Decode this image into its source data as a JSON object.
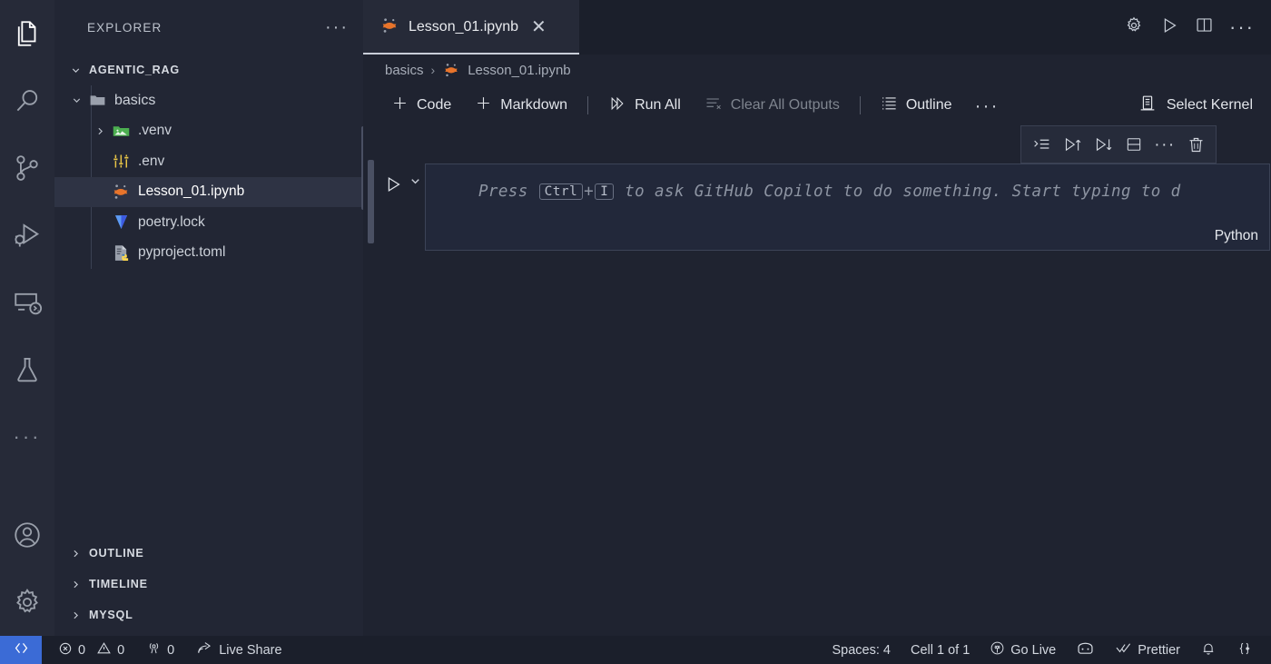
{
  "activity_bar": {
    "items": [
      {
        "name": "explorer",
        "icon": "files-icon",
        "active": true
      },
      {
        "name": "search",
        "icon": "search-icon",
        "active": false
      },
      {
        "name": "source-control",
        "icon": "source-control-icon",
        "active": false
      },
      {
        "name": "run-and-debug",
        "icon": "run-debug-icon",
        "active": false
      },
      {
        "name": "remote-explorer",
        "icon": "remote-explorer-icon",
        "active": false
      },
      {
        "name": "testing",
        "icon": "testing-flask-icon",
        "active": false
      },
      {
        "name": "additional-views",
        "icon": "ellipsis-icon",
        "active": false
      }
    ],
    "bottom": [
      {
        "name": "accounts",
        "icon": "account-icon"
      },
      {
        "name": "settings",
        "icon": "gear-icon"
      }
    ]
  },
  "sidebar": {
    "title": "EXPLORER",
    "more_actions": "···",
    "workspace": "AGENTIC_RAG",
    "tree": [
      {
        "label": "basics",
        "icon": "folder-open-icon",
        "depth": 1,
        "expandable": true,
        "expanded": true,
        "selected": false
      },
      {
        "label": ".venv",
        "icon": "venv-folder-icon",
        "depth": 2,
        "expandable": true,
        "expanded": false,
        "selected": false
      },
      {
        "label": ".env",
        "icon": "env-settings-icon",
        "depth": 2,
        "expandable": false,
        "expanded": false,
        "selected": false
      },
      {
        "label": "Lesson_01.ipynb",
        "icon": "jupyter-icon",
        "depth": 2,
        "expandable": false,
        "expanded": false,
        "selected": true
      },
      {
        "label": "poetry.lock",
        "icon": "poetry-icon",
        "depth": 2,
        "expandable": false,
        "expanded": false,
        "selected": false
      },
      {
        "label": "pyproject.toml",
        "icon": "python-toml-icon",
        "depth": 2,
        "expandable": false,
        "expanded": false,
        "selected": false
      }
    ],
    "bottom_sections": [
      {
        "label": "OUTLINE",
        "expanded": false
      },
      {
        "label": "TIMELINE",
        "expanded": false
      },
      {
        "label": "MYSQL",
        "expanded": false
      }
    ]
  },
  "editor": {
    "tab": {
      "label": "Lesson_01.ipynb",
      "icon": "jupyter-icon",
      "close": "✕",
      "active": true
    },
    "actions": [
      {
        "name": "notebook-settings",
        "icon": "gear-icon"
      },
      {
        "name": "run-notebook",
        "icon": "play-icon"
      },
      {
        "name": "split-editor",
        "icon": "split-editor-icon"
      },
      {
        "name": "more-editor-actions",
        "icon": "ellipsis-icon",
        "glyph": "···"
      }
    ],
    "breadcrumb": {
      "folder": "basics",
      "separator": "›",
      "file": "Lesson_01.ipynb"
    },
    "notebook_toolbar": {
      "add_code": "Code",
      "add_markdown": "Markdown",
      "run_all": "Run All",
      "clear_all_outputs": "Clear All Outputs",
      "outline": "Outline",
      "more": "···",
      "select_kernel": "Select Kernel"
    },
    "cell_toolbar": [
      {
        "name": "run-by-line",
        "icon": "run-by-line-icon"
      },
      {
        "name": "execute-above-cells",
        "icon": "run-above-icon"
      },
      {
        "name": "execute-cell-below",
        "icon": "run-below-icon"
      },
      {
        "name": "split-cell",
        "icon": "split-cell-icon"
      },
      {
        "name": "more-cell-actions",
        "icon": "ellipsis-icon",
        "glyph": "···"
      },
      {
        "name": "delete-cell",
        "icon": "trash-icon"
      }
    ],
    "cell": {
      "placeholder_prefix": "Press ",
      "key_1": "Ctrl",
      "key_plus": "+",
      "key_2": "I",
      "placeholder_suffix": " to ask GitHub Copilot to do something. Start typing to d",
      "language": "Python"
    }
  },
  "status_bar": {
    "remote_icon": "remote-window-icon",
    "left": [
      {
        "name": "problems-errors",
        "icon": "error-circle-icon",
        "text": "0"
      },
      {
        "name": "problems-warnings",
        "icon": "warning-triangle-icon",
        "text": "0"
      },
      {
        "name": "ports",
        "icon": "radio-tower-icon",
        "text": "0"
      },
      {
        "name": "live-share",
        "icon": "live-share-icon",
        "text": "Live Share"
      }
    ],
    "right": [
      {
        "name": "indentation",
        "icon": "",
        "text": "Spaces: 4"
      },
      {
        "name": "cell-position",
        "icon": "",
        "text": "Cell 1 of 1"
      },
      {
        "name": "go-live",
        "icon": "broadcast-icon",
        "text": "Go Live"
      },
      {
        "name": "copilot",
        "icon": "copilot-icon",
        "text": ""
      },
      {
        "name": "prettier",
        "icon": "check-all-icon",
        "text": "Prettier"
      },
      {
        "name": "notifications",
        "icon": "bell-icon",
        "text": ""
      },
      {
        "name": "editor-status",
        "icon": "braces-icon",
        "text": ""
      }
    ]
  },
  "colors": {
    "activity_bar_bg": "#262a38",
    "sidebar_bg": "#222634",
    "editor_bg": "#1f2330",
    "tabbar_bg": "#1b1f2b",
    "tab_active_bg": "#262a38",
    "statusbar_bg": "#1b1f2b",
    "remote_blue": "#3b6bd6",
    "selection_bg": "#2e3344",
    "cell_bg": "#22283a",
    "cell_border": "#3c4357",
    "jupyter_orange": "#e8742b",
    "venv_green": "#4caf50",
    "env_yellow": "#e8c547",
    "poetry_blue": "#3c5ae0"
  }
}
